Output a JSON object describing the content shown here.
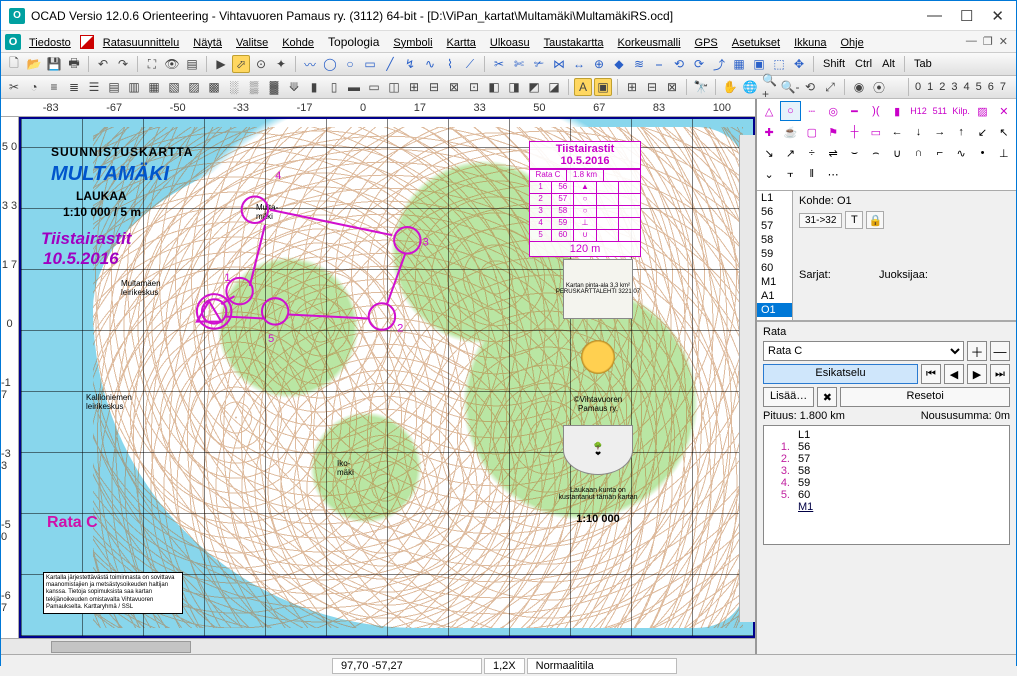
{
  "title": "OCAD Versio 12.0.6  Orienteering - Vihtavuoren Pamaus ry. (3112) 64-bit - [D:\\ViPan_kartat\\Multamäki\\MultamäkiRS.ocd]",
  "menu": {
    "file": "Tiedosto",
    "route": "Ratasuunnittelu",
    "view": "Näytä",
    "select": "Valitse",
    "object": "Kohde",
    "topology": "Topologia",
    "symbol": "Symboli",
    "map": "Kartta",
    "layout": "Ulkoasu",
    "bgmap": "Taustakartta",
    "dem": "Korkeusmalli",
    "gps": "GPS",
    "settings": "Asetukset",
    "window": "Ikkuna",
    "help": "Ohje"
  },
  "mods": {
    "shift": "Shift",
    "ctrl": "Ctrl",
    "alt": "Alt",
    "tab": "Tab"
  },
  "nums": [
    "0",
    "1",
    "2",
    "3",
    "4",
    "5",
    "6",
    "7"
  ],
  "hruler": [
    "-83",
    "-67",
    "-50",
    "-33",
    "-17",
    "0",
    "17",
    "33",
    "50",
    "67",
    "83",
    "100"
  ],
  "vruler": [
    "5 0",
    "3 3",
    "1 7",
    "0",
    "-1 7",
    "-3 3",
    "-5 0",
    "-6 7"
  ],
  "map": {
    "title1": "SUUNNISTUSKARTTA",
    "title2": "MULTAMÄKI",
    "sub1": "LAUKAA",
    "sub2": "1:10 000 / 5 m",
    "event1": "Tiistairastit",
    "event2": "10.5.2016",
    "rata": "Rata C",
    "place1": "Multamäen\nleirikeskus",
    "place2": "Kallioniemen\nleirikeskus",
    "place3": "Iko-\nmäki",
    "place4": "Multa-\nmäki",
    "scale": "1:10 000",
    "legend": "Kartalla järjestettävästä toiminnasta on sovittava maanomistajien ja metsästysoikeuden haltijan kanssa. Tietoja sopimuksista saa kartan tekijänoikeuden omistavalta Vihtavuoren Pamaukselta. Karttaryhmä / SSL",
    "credit": "Kartan pinta-ala 3,3 km²\nPERUSKARTTALEHTI 3221 07",
    "org": "©Vihtavuoren\nPamaus ry.",
    "kunta": "Laukaan kunta on kustantanut tämän kartan"
  },
  "ctable": {
    "hd": "Tiistairastit 10.5.2016",
    "c1": "Rata C",
    "c2": "1.8 km",
    "rows": [
      [
        "1",
        "56",
        "▲"
      ],
      [
        "2",
        "57",
        "○"
      ],
      [
        "3",
        "58",
        "○"
      ],
      [
        "4",
        "59",
        "⊥"
      ],
      [
        "5",
        "60",
        "∪"
      ]
    ],
    "ft": "120 m"
  },
  "symlabels": {
    "h12": "H12",
    "n511": "511",
    "kilp": "Kilp."
  },
  "leftlist": [
    "L1",
    "56",
    "57",
    "58",
    "59",
    "60",
    "M1",
    "A1",
    "O1"
  ],
  "obj": {
    "label": "Kohde:",
    "val": "O1",
    "leg": "31->32",
    "t": "T",
    "sarjat": "Sarjat:",
    "juoksija": "Juoksijaa:"
  },
  "rata": {
    "ttl": "Rata",
    "sel": "Rata C",
    "preview": "Esikatselu",
    "add": "Lisää…",
    "reset": "Resetoi",
    "len": "Pituus: 1.800 km",
    "climb": "Noususumma: 0m"
  },
  "ctrls": [
    [
      "",
      "L1"
    ],
    [
      "1.",
      "56"
    ],
    [
      "2.",
      "57"
    ],
    [
      "3.",
      "58"
    ],
    [
      "4.",
      "59"
    ],
    [
      "5.",
      "60"
    ],
    [
      "",
      "M1"
    ]
  ],
  "status": {
    "coord": "97,70  -57,27",
    "zoom": "1,2X",
    "mode": "Normaalitila"
  }
}
